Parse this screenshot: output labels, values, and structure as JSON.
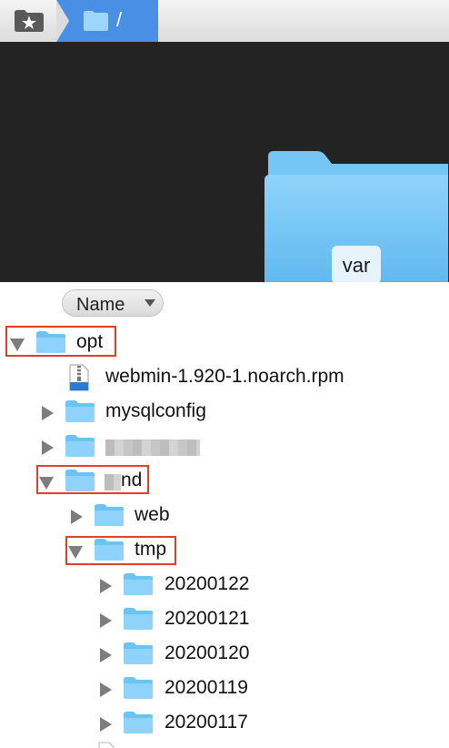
{
  "path_bar": {
    "favorites_icon": "star-folder-icon",
    "current_path": "/"
  },
  "preview": {
    "folder_name": "var",
    "icon": "large-folder-icon"
  },
  "header": {
    "name_column": "Name",
    "sort_icon": "sort-down-icon"
  },
  "tree": [
    {
      "label": "opt",
      "type": "folder",
      "expanded": true,
      "highlighted": true
    },
    {
      "label": "webmin-1.920-1.noarch.rpm",
      "type": "rpm-file"
    },
    {
      "label": "mysqlconfig",
      "type": "folder",
      "expanded": false
    },
    {
      "label": "",
      "type": "folder",
      "expanded": false,
      "redacted": true
    },
    {
      "label": "nd",
      "type": "folder",
      "expanded": true,
      "highlighted": true,
      "partially_redacted": true
    },
    {
      "label": "web",
      "type": "folder",
      "expanded": false
    },
    {
      "label": "tmp",
      "type": "folder",
      "expanded": true,
      "highlighted": true
    },
    {
      "label": "20200122",
      "type": "folder",
      "expanded": false
    },
    {
      "label": "20200121",
      "type": "folder",
      "expanded": false
    },
    {
      "label": "20200120",
      "type": "folder",
      "expanded": false
    },
    {
      "label": "20200119",
      "type": "folder",
      "expanded": false
    },
    {
      "label": "20200117",
      "type": "folder",
      "expanded": false
    }
  ],
  "colors": {
    "highlight_border": "#e0402a",
    "folder_blue": "#6cc4f5",
    "crumb_blue": "#4a8fe6"
  }
}
